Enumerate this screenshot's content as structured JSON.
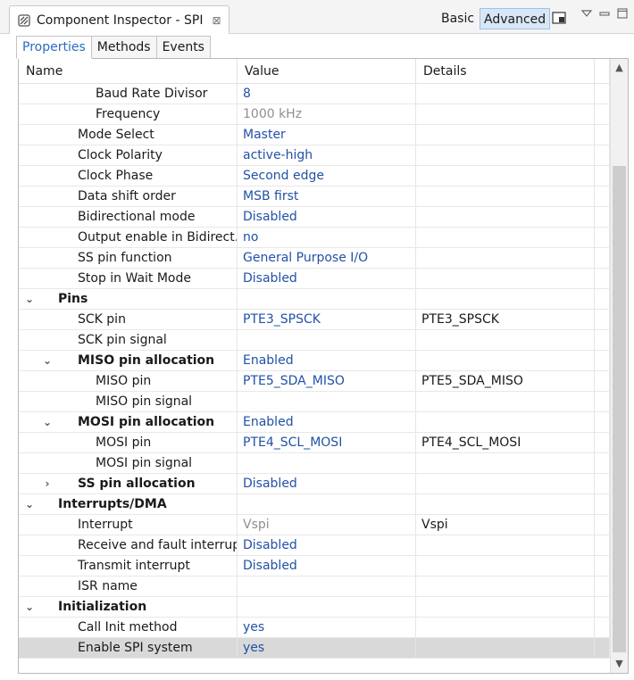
{
  "view": {
    "title": "Component Inspector - SPI",
    "close_glyph": "⊠",
    "icon": "component-inspector-icon",
    "mode_basic": "Basic",
    "mode_advanced": "Advanced"
  },
  "tabs": [
    {
      "label": "Properties",
      "active": true
    },
    {
      "label": "Methods",
      "active": false
    },
    {
      "label": "Events",
      "active": false
    }
  ],
  "table": {
    "headers": {
      "name": "Name",
      "value": "Value",
      "details": "Details"
    },
    "rows": [
      {
        "name": "Baud Rate Divisor",
        "value": "8",
        "details": "",
        "depth": 3,
        "expander": "",
        "group": false,
        "value_disabled": false
      },
      {
        "name": "Frequency",
        "value": "1000 kHz",
        "details": "",
        "depth": 3,
        "expander": "",
        "group": false,
        "value_disabled": true
      },
      {
        "name": "Mode Select",
        "value": "Master",
        "details": "",
        "depth": 2,
        "expander": "",
        "group": false,
        "value_disabled": false
      },
      {
        "name": "Clock Polarity",
        "value": "active-high",
        "details": "",
        "depth": 2,
        "expander": "",
        "group": false,
        "value_disabled": false
      },
      {
        "name": "Clock Phase",
        "value": "Second edge",
        "details": "",
        "depth": 2,
        "expander": "",
        "group": false,
        "value_disabled": false
      },
      {
        "name": "Data shift order",
        "value": "MSB first",
        "details": "",
        "depth": 2,
        "expander": "",
        "group": false,
        "value_disabled": false
      },
      {
        "name": "Bidirectional mode",
        "value": "Disabled",
        "details": "",
        "depth": 2,
        "expander": "",
        "group": false,
        "value_disabled": false
      },
      {
        "name": "Output enable in Bidirect.",
        "value": "no",
        "details": "",
        "depth": 2,
        "expander": "",
        "group": false,
        "value_disabled": false
      },
      {
        "name": "SS pin function",
        "value": "General Purpose I/O",
        "details": "",
        "depth": 2,
        "expander": "",
        "group": false,
        "value_disabled": false
      },
      {
        "name": "Stop in Wait Mode",
        "value": "Disabled",
        "details": "",
        "depth": 2,
        "expander": "",
        "group": false,
        "value_disabled": false
      },
      {
        "name": "Pins",
        "value": "",
        "details": "",
        "depth": 1,
        "expander": "expanded",
        "group": true,
        "value_disabled": false
      },
      {
        "name": "SCK pin",
        "value": "PTE3_SPSCK",
        "details": "PTE3_SPSCK",
        "depth": 2,
        "expander": "",
        "group": false,
        "value_disabled": false
      },
      {
        "name": "SCK pin signal",
        "value": "",
        "details": "",
        "depth": 2,
        "expander": "",
        "group": false,
        "value_disabled": false
      },
      {
        "name": "MISO pin allocation",
        "value": "Enabled",
        "details": "",
        "depth": 2,
        "expander": "expanded",
        "group": true,
        "value_disabled": false
      },
      {
        "name": "MISO pin",
        "value": "PTE5_SDA_MISO",
        "details": "PTE5_SDA_MISO",
        "depth": 3,
        "expander": "",
        "group": false,
        "value_disabled": false
      },
      {
        "name": "MISO pin signal",
        "value": "",
        "details": "",
        "depth": 3,
        "expander": "",
        "group": false,
        "value_disabled": false
      },
      {
        "name": "MOSI pin allocation",
        "value": "Enabled",
        "details": "",
        "depth": 2,
        "expander": "expanded",
        "group": true,
        "value_disabled": false
      },
      {
        "name": "MOSI pin",
        "value": "PTE4_SCL_MOSI",
        "details": "PTE4_SCL_MOSI",
        "depth": 3,
        "expander": "",
        "group": false,
        "value_disabled": false
      },
      {
        "name": "MOSI pin signal",
        "value": "",
        "details": "",
        "depth": 3,
        "expander": "",
        "group": false,
        "value_disabled": false
      },
      {
        "name": "SS pin allocation",
        "value": "Disabled",
        "details": "",
        "depth": 2,
        "expander": "collapsed",
        "group": true,
        "value_disabled": false
      },
      {
        "name": "Interrupts/DMA",
        "value": "",
        "details": "",
        "depth": 1,
        "expander": "expanded",
        "group": true,
        "value_disabled": false
      },
      {
        "name": "Interrupt",
        "value": "Vspi",
        "details": "Vspi",
        "depth": 2,
        "expander": "",
        "group": false,
        "value_disabled": true
      },
      {
        "name": "Receive and fault interrupt",
        "value": "Disabled",
        "details": "",
        "depth": 2,
        "expander": "",
        "group": false,
        "value_disabled": false
      },
      {
        "name": "Transmit interrupt",
        "value": "Disabled",
        "details": "",
        "depth": 2,
        "expander": "",
        "group": false,
        "value_disabled": false
      },
      {
        "name": "ISR name",
        "value": "",
        "details": "",
        "depth": 2,
        "expander": "",
        "group": false,
        "value_disabled": false
      },
      {
        "name": "Initialization",
        "value": "",
        "details": "",
        "depth": 1,
        "expander": "expanded",
        "group": true,
        "value_disabled": false
      },
      {
        "name": "Call Init method",
        "value": "yes",
        "details": "",
        "depth": 2,
        "expander": "",
        "group": false,
        "value_disabled": false
      },
      {
        "name": "Enable SPI system",
        "value": "yes",
        "details": "",
        "depth": 2,
        "expander": "",
        "group": false,
        "value_disabled": false,
        "selected": true
      }
    ]
  },
  "icons": {
    "expanded": "chevron-down-icon",
    "collapsed": "chevron-right-icon",
    "scroll_up": "scroll-up-icon",
    "scroll_down": "scroll-down-icon"
  }
}
